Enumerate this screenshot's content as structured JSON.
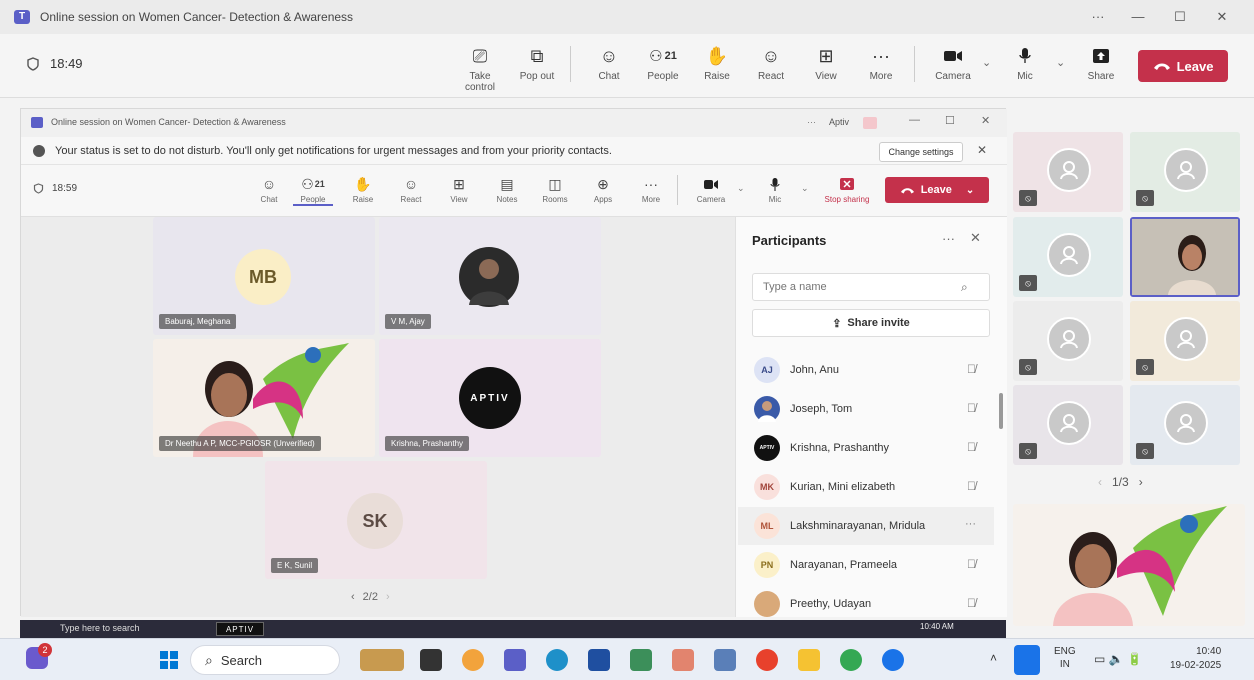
{
  "outer": {
    "title": "Online session on Women Cancer- Detection & Awareness",
    "time": "18:49",
    "people_count": "21",
    "toolbar": [
      {
        "label": "Take control",
        "icon": "take-control-icon"
      },
      {
        "label": "Pop out",
        "icon": "pop-out-icon"
      },
      {
        "label": "Chat",
        "icon": "chat-icon"
      },
      {
        "label": "People",
        "icon": "people-icon"
      },
      {
        "label": "Raise",
        "icon": "raise-hand-icon"
      },
      {
        "label": "React",
        "icon": "react-icon"
      },
      {
        "label": "View",
        "icon": "view-icon"
      },
      {
        "label": "More",
        "icon": "more-icon"
      },
      {
        "label": "Camera",
        "icon": "camera-icon"
      },
      {
        "label": "Mic",
        "icon": "mic-icon"
      },
      {
        "label": "Share",
        "icon": "share-icon"
      }
    ],
    "leave_label": "Leave",
    "pager": "1/3"
  },
  "inner": {
    "title": "Online session on Women Cancer- Detection & Awareness",
    "org": "Aptiv",
    "notification": "Your status is set to do not disturb. You'll only get notifications for urgent messages and from your priority contacts.",
    "change_settings": "Change settings",
    "time": "18:59",
    "people_count": "21",
    "toolbar": [
      {
        "label": "Chat"
      },
      {
        "label": "People"
      },
      {
        "label": "Raise"
      },
      {
        "label": "React"
      },
      {
        "label": "View"
      },
      {
        "label": "Notes"
      },
      {
        "label": "Rooms"
      },
      {
        "label": "Apps"
      },
      {
        "label": "More"
      },
      {
        "label": "Camera"
      },
      {
        "label": "Mic"
      },
      {
        "label": "Stop sharing"
      }
    ],
    "leave_label": "Leave",
    "tiles": [
      {
        "name": "Baburaj, Meghana",
        "initials": "MB"
      },
      {
        "name": "V M, Ajay"
      },
      {
        "name": "Dr Neethu A P, MCC-PGIOSR (Unverified)"
      },
      {
        "name": "Krishna, Prashanthy",
        "logo": "APTIV"
      },
      {
        "name": "E K, Sunil",
        "initials": "SK"
      }
    ],
    "pager": "2/2"
  },
  "participants": {
    "title": "Participants",
    "search_placeholder": "Type a name",
    "share_invite": "Share invite",
    "list": [
      {
        "name": "John, Anu",
        "initials": "AJ"
      },
      {
        "name": "Joseph, Tom"
      },
      {
        "name": "Krishna, Prashanthy"
      },
      {
        "name": "Kurian, Mini elizabeth",
        "initials": "MK"
      },
      {
        "name": "Lakshminarayanan, Mridula",
        "initials": "ML"
      },
      {
        "name": "Narayanan, Prameela",
        "initials": "PN"
      },
      {
        "name": "Preethy, Udayan"
      }
    ]
  },
  "inner_taskbar": {
    "search": "Type here to search",
    "aptiv": "APTIV",
    "time": "10:40 AM"
  },
  "taskbar": {
    "search": "Search",
    "badge": "2",
    "lang": "ENG",
    "region": "IN",
    "time": "10:40",
    "date": "19-02-2025"
  },
  "colors": {
    "leave": "#c4314b",
    "accent": "#5b5fc7"
  }
}
